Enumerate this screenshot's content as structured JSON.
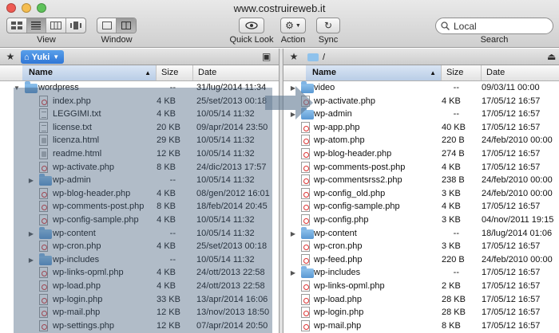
{
  "window": {
    "title": "www.costruireweb.it"
  },
  "toolbar": {
    "view_label": "View",
    "window_label": "Window",
    "quicklook_label": "Quick Look",
    "action_label": "Action",
    "sync_label": "Sync",
    "search_label": "Search",
    "search_value": "Local"
  },
  "left_pane": {
    "location": "Yuki",
    "columns": {
      "name": "Name",
      "size": "Size",
      "date": "Date"
    },
    "rows": [
      {
        "name": "wordpress",
        "size": "--",
        "date": "31/lug/2014 11:34",
        "kind": "folder",
        "open": true,
        "indent": 0
      },
      {
        "name": "index.php",
        "size": "4 KB",
        "date": "25/set/2013 00:18",
        "kind": "php",
        "indent": 1
      },
      {
        "name": "LEGGIMI.txt",
        "size": "4 KB",
        "date": "10/05/14 11:32",
        "kind": "txt",
        "indent": 1
      },
      {
        "name": "license.txt",
        "size": "20 KB",
        "date": "09/apr/2014 23:50",
        "kind": "txt",
        "indent": 1
      },
      {
        "name": "licenza.html",
        "size": "29 KB",
        "date": "10/05/14 11:32",
        "kind": "html",
        "indent": 1
      },
      {
        "name": "readme.html",
        "size": "12 KB",
        "date": "10/05/14 11:32",
        "kind": "html",
        "indent": 1
      },
      {
        "name": "wp-activate.php",
        "size": "8 KB",
        "date": "24/dic/2013 17:57",
        "kind": "php",
        "indent": 1
      },
      {
        "name": "wp-admin",
        "size": "--",
        "date": "10/05/14 11:32",
        "kind": "folder",
        "indent": 1
      },
      {
        "name": "wp-blog-header.php",
        "size": "4 KB",
        "date": "08/gen/2012 16:01",
        "kind": "php",
        "indent": 1
      },
      {
        "name": "wp-comments-post.php",
        "size": "8 KB",
        "date": "18/feb/2014 20:45",
        "kind": "php",
        "indent": 1
      },
      {
        "name": "wp-config-sample.php",
        "size": "4 KB",
        "date": "10/05/14 11:32",
        "kind": "php",
        "indent": 1
      },
      {
        "name": "wp-content",
        "size": "--",
        "date": "10/05/14 11:32",
        "kind": "folder",
        "indent": 1
      },
      {
        "name": "wp-cron.php",
        "size": "4 KB",
        "date": "25/set/2013 00:18",
        "kind": "php",
        "indent": 1
      },
      {
        "name": "wp-includes",
        "size": "--",
        "date": "10/05/14 11:32",
        "kind": "folder",
        "indent": 1
      },
      {
        "name": "wp-links-opml.php",
        "size": "4 KB",
        "date": "24/ott/2013 22:58",
        "kind": "php",
        "indent": 1
      },
      {
        "name": "wp-load.php",
        "size": "4 KB",
        "date": "24/ott/2013 22:58",
        "kind": "php",
        "indent": 1
      },
      {
        "name": "wp-login.php",
        "size": "33 KB",
        "date": "13/apr/2014 16:06",
        "kind": "php",
        "indent": 1
      },
      {
        "name": "wp-mail.php",
        "size": "12 KB",
        "date": "13/nov/2013 18:50",
        "kind": "php",
        "indent": 1
      },
      {
        "name": "wp-settings.php",
        "size": "12 KB",
        "date": "07/apr/2014 20:50",
        "kind": "php",
        "indent": 1
      }
    ]
  },
  "right_pane": {
    "location": "/",
    "columns": {
      "name": "Name",
      "size": "Size",
      "date": "Date"
    },
    "rows": [
      {
        "name": "video",
        "size": "--",
        "date": "09/03/11 00:00",
        "kind": "folder"
      },
      {
        "name": "wp-activate.php",
        "size": "4 KB",
        "date": "17/05/12 16:57",
        "kind": "php"
      },
      {
        "name": "wp-admin",
        "size": "--",
        "date": "17/05/12 16:57",
        "kind": "folder"
      },
      {
        "name": "wp-app.php",
        "size": "40 KB",
        "date": "17/05/12 16:57",
        "kind": "php"
      },
      {
        "name": "wp-atom.php",
        "size": "220 B",
        "date": "24/feb/2010 00:00",
        "kind": "php"
      },
      {
        "name": "wp-blog-header.php",
        "size": "274 B",
        "date": "17/05/12 16:57",
        "kind": "php"
      },
      {
        "name": "wp-comments-post.php",
        "size": "4 KB",
        "date": "17/05/12 16:57",
        "kind": "php"
      },
      {
        "name": "wp-commentsrss2.php",
        "size": "238 B",
        "date": "24/feb/2010 00:00",
        "kind": "php"
      },
      {
        "name": "wp-config_old.php",
        "size": "3 KB",
        "date": "24/feb/2010 00:00",
        "kind": "php"
      },
      {
        "name": "wp-config-sample.php",
        "size": "4 KB",
        "date": "17/05/12 16:57",
        "kind": "php"
      },
      {
        "name": "wp-config.php",
        "size": "3 KB",
        "date": "04/nov/2011 19:15",
        "kind": "php"
      },
      {
        "name": "wp-content",
        "size": "--",
        "date": "18/lug/2014 01:06",
        "kind": "folder"
      },
      {
        "name": "wp-cron.php",
        "size": "3 KB",
        "date": "17/05/12 16:57",
        "kind": "php"
      },
      {
        "name": "wp-feed.php",
        "size": "220 B",
        "date": "24/feb/2010 00:00",
        "kind": "php"
      },
      {
        "name": "wp-includes",
        "size": "--",
        "date": "17/05/12 16:57",
        "kind": "folder"
      },
      {
        "name": "wp-links-opml.php",
        "size": "2 KB",
        "date": "17/05/12 16:57",
        "kind": "php"
      },
      {
        "name": "wp-load.php",
        "size": "28 KB",
        "date": "17/05/12 16:57",
        "kind": "php"
      },
      {
        "name": "wp-login.php",
        "size": "28 KB",
        "date": "17/05/12 16:57",
        "kind": "php"
      },
      {
        "name": "wp-mail.php",
        "size": "8 KB",
        "date": "17/05/12 16:57",
        "kind": "php"
      }
    ]
  }
}
